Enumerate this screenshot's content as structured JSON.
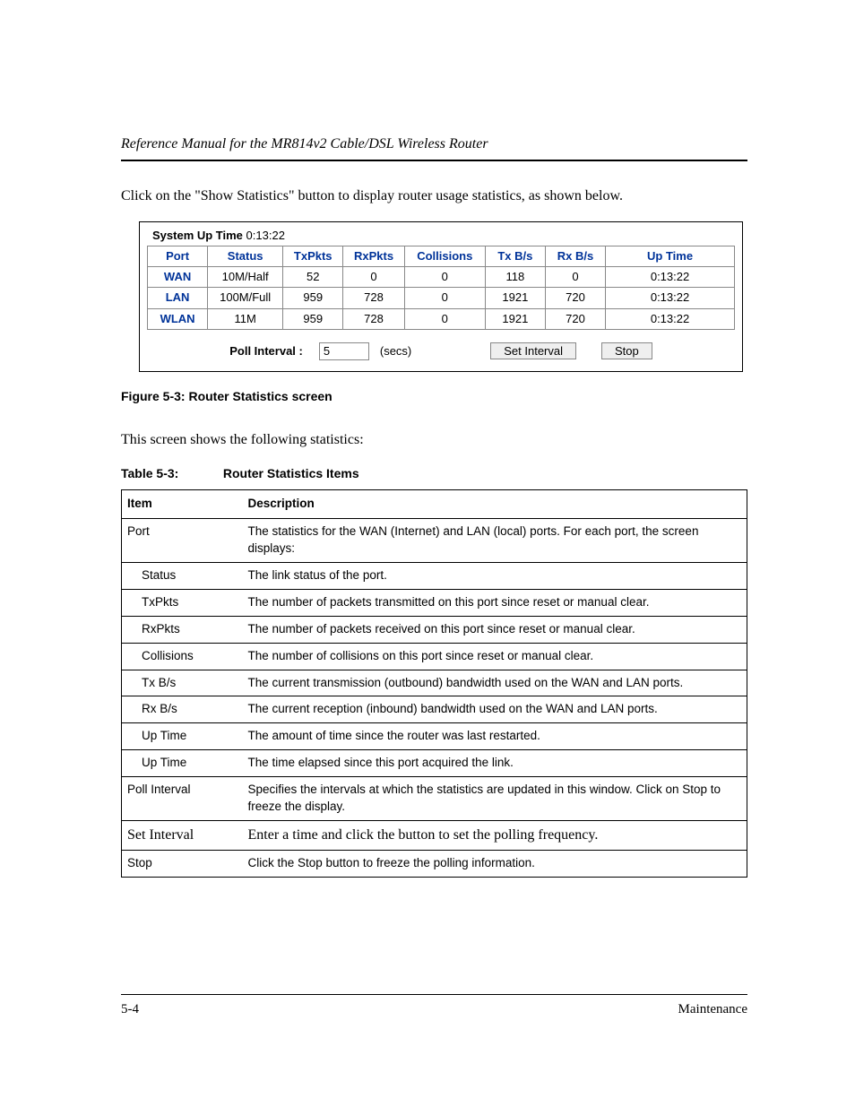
{
  "header": {
    "title": "Reference Manual for the MR814v2 Cable/DSL Wireless Router"
  },
  "intro": "Click on the \"Show Statistics\" button to display router usage statistics, as shown below.",
  "screenshot": {
    "uptime_label": "System Up Time",
    "uptime_value": "0:13:22",
    "headers": {
      "port": "Port",
      "status": "Status",
      "txpkts": "TxPkts",
      "rxpkts": "RxPkts",
      "collisions": "Collisions",
      "txbs": "Tx B/s",
      "rxbs": "Rx B/s",
      "uptime": "Up Time"
    },
    "rows": [
      {
        "port": "WAN",
        "status": "10M/Half",
        "txpkts": "52",
        "rxpkts": "0",
        "collisions": "0",
        "txbs": "118",
        "rxbs": "0",
        "uptime": "0:13:22"
      },
      {
        "port": "LAN",
        "status": "100M/Full",
        "txpkts": "959",
        "rxpkts": "728",
        "collisions": "0",
        "txbs": "1921",
        "rxbs": "720",
        "uptime": "0:13:22"
      },
      {
        "port": "WLAN",
        "status": "11M",
        "txpkts": "959",
        "rxpkts": "728",
        "collisions": "0",
        "txbs": "1921",
        "rxbs": "720",
        "uptime": "0:13:22"
      }
    ],
    "poll": {
      "label": "Poll Interval :",
      "value": "5",
      "unit": "(secs)",
      "set_btn": "Set Interval",
      "stop_btn": "Stop"
    }
  },
  "figure_caption": "Figure 5-3:  Router Statistics screen",
  "section_text": "This screen shows the following statistics:",
  "table_caption": {
    "label": "Table 5-3:",
    "title": "Router Statistics Items"
  },
  "desc_table": {
    "headers": {
      "item": "Item",
      "desc": "Description"
    },
    "rows": [
      {
        "item": "Port",
        "indent": false,
        "desc": "The statistics for the WAN (Internet) and LAN (local) ports. For each port, the screen displays:"
      },
      {
        "item": "Status",
        "indent": true,
        "desc": "The link status of the port."
      },
      {
        "item": "TxPkts",
        "indent": true,
        "desc": "The number of packets transmitted on this port since reset or manual clear."
      },
      {
        "item": "RxPkts",
        "indent": true,
        "desc": "The number of packets received on this port since reset or manual clear."
      },
      {
        "item": "Collisions",
        "indent": true,
        "desc": "The number of collisions on this port since reset or manual clear."
      },
      {
        "item": "Tx B/s",
        "indent": true,
        "desc": "The current transmission (outbound) bandwidth used on the WAN and LAN ports."
      },
      {
        "item": "Rx B/s",
        "indent": true,
        "desc": "The current reception (inbound) bandwidth used on the WAN and LAN ports."
      },
      {
        "item": "Up Time",
        "indent": true,
        "desc": "The amount of time since the router was last restarted."
      },
      {
        "item": "Up Time",
        "indent": true,
        "desc": "The time elapsed since this port acquired the link."
      },
      {
        "item": "Poll Interval",
        "indent": false,
        "desc": "Specifies the intervals at which the statistics are updated in this window. Click on Stop to freeze the display."
      },
      {
        "item": "Set Interval",
        "indent": false,
        "serif": true,
        "desc": "Enter a time and click the button to set the polling frequency."
      },
      {
        "item": "Stop",
        "indent": false,
        "desc": "Click the Stop button to freeze the polling information."
      }
    ]
  },
  "footer": {
    "left": "5-4",
    "right": "Maintenance"
  }
}
